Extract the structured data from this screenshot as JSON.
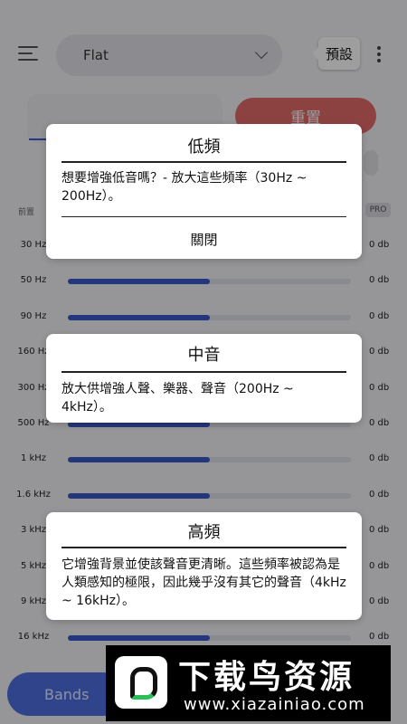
{
  "header": {
    "preset_name": "Flat",
    "tooltip_label": "預設"
  },
  "controls": {
    "reset_label": "重置",
    "pre_amp_label": "前置",
    "pro_badge": "PRO"
  },
  "bands": [
    {
      "label": "30 Hz",
      "value": "0 db",
      "level": 0.5
    },
    {
      "label": "50 Hz",
      "value": "0 db",
      "level": 0.5
    },
    {
      "label": "90 Hz",
      "value": "0 db",
      "level": 0.5
    },
    {
      "label": "160 Hz",
      "value": "0 db",
      "level": 0.5
    },
    {
      "label": "300 Hz",
      "value": "0 db",
      "level": 0.5
    },
    {
      "label": "500 Hz",
      "value": "0 db",
      "level": 0.5
    },
    {
      "label": "1 kHz",
      "value": "0 db",
      "level": 0.5
    },
    {
      "label": "1.6 kHz",
      "value": "0 db",
      "level": 0.5
    },
    {
      "label": "3 kHz",
      "value": "0 db",
      "level": 0.5
    },
    {
      "label": "5 kHz",
      "value": "0 db",
      "level": 0.5
    },
    {
      "label": "9 kHz",
      "value": "0 db",
      "level": 0.5
    },
    {
      "label": "16 kHz",
      "value": "0 db",
      "level": 0.5
    }
  ],
  "footer": {
    "bands_button": "Bands"
  },
  "cards": {
    "low": {
      "title": "低頻",
      "body": "想要增強低音嗎？- 放大這些頻率（30Hz ~ 200Hz）。",
      "close": "關閉"
    },
    "mid": {
      "title": "中音",
      "body": "放大供增強人聲、樂器、聲音（200Hz ~ 4kHz）。"
    },
    "high": {
      "title": "高頻",
      "body": "它增強背景並使該聲音更清晰。這些頻率被認為是人類感知的極限，因此幾乎沒有其它的聲音（4kHz ~ 16kHz）。"
    }
  },
  "watermark": {
    "title": "下载鸟资源",
    "url": "www.xiazainiao.com"
  },
  "colors": {
    "accent": "#3a57c9",
    "reset": "#e46b6b",
    "bands_button": "#4d6fe0"
  }
}
